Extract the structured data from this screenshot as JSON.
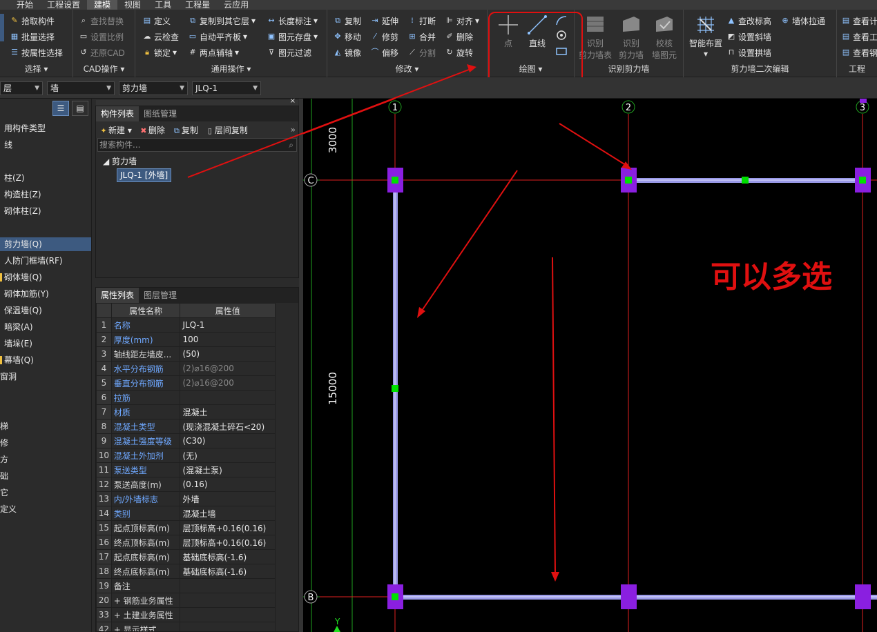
{
  "menu": [
    "开始",
    "工程设置",
    "建模",
    "视图",
    "工具",
    "工程量",
    "云应用"
  ],
  "ribbon": {
    "select": {
      "items": [
        "拾取构件",
        "批量选择",
        "按属性选择"
      ],
      "label": "选择"
    },
    "cad": {
      "items": [
        "查找替换",
        "设置比例",
        "还原CAD"
      ],
      "label": "CAD操作"
    },
    "common": {
      "items": [
        "定义",
        "云检查",
        "锁定",
        "复制到其它层",
        "自动平齐板",
        "两点辅轴",
        "长度标注",
        "图元存盘",
        "图元过滤"
      ],
      "label": "通用操作"
    },
    "modify": {
      "items": [
        "复制",
        "延伸",
        "打断",
        "对齐",
        "移动",
        "修剪",
        "合并",
        "删除",
        "镜像",
        "偏移",
        "分割",
        "旋转"
      ],
      "label": "修改"
    },
    "draw": {
      "point": "点",
      "line": "直线",
      "label": "绘图"
    },
    "recognize": {
      "items": [
        "识别剪力墙表",
        "识别剪力墙",
        "校核墙图元"
      ],
      "label": "识别剪力墙",
      "i1a": "识别",
      "i1b": "剪力墙表",
      "i2a": "识别",
      "i2b": "剪力墙",
      "i3a": "校核",
      "i3b": "墙图元"
    },
    "edit2": {
      "smart": "智能布置",
      "items": [
        "查改标高",
        "墙体拉通",
        "设置斜墙",
        "设置拱墙"
      ],
      "label": "剪力墙二次编辑"
    },
    "project": {
      "items": [
        "查看计",
        "查看工",
        "查看钢"
      ],
      "label": "工程"
    }
  },
  "toolbar2": {
    "c1": "层",
    "c2": "墙",
    "c3": "剪力墙",
    "c4": "JLQ-1"
  },
  "leftnav": [
    "用构件类型",
    "线",
    "柱(Z)",
    "构造柱(Z)",
    "砌体柱(Z)",
    "剪力墙(Q)",
    "人防门框墙(RF)",
    "砌体墙(Q)",
    "砌体加筋(Y)",
    "保温墙(Q)",
    "暗梁(A)",
    "墙垛(E)",
    "幕墙(Q)",
    "窗洞",
    "梯",
    "修",
    "方",
    "础",
    "它",
    "定义"
  ],
  "complist": {
    "tab1": "构件列表",
    "tab2": "图纸管理",
    "new": "新建",
    "del": "删除",
    "copy": "复制",
    "floorcopy": "层间复制",
    "search_placeholder": "搜索构件...",
    "group": "剪力墙",
    "leaf": "JLQ-1 [外墙]"
  },
  "proplist": {
    "tab1": "属性列表",
    "tab2": "图层管理",
    "h_name": "属性名称",
    "h_val": "属性值",
    "rows": [
      {
        "n": "1",
        "name": "名称",
        "val": "JLQ-1"
      },
      {
        "n": "2",
        "name": "厚度(mm)",
        "val": "100"
      },
      {
        "n": "3",
        "name": "轴线距左墙皮...",
        "val": "(50)"
      },
      {
        "n": "4",
        "name": "水平分布钢筋",
        "val": "(2)⌀16@200"
      },
      {
        "n": "5",
        "name": "垂直分布钢筋",
        "val": "(2)⌀16@200"
      },
      {
        "n": "6",
        "name": "拉筋",
        "val": ""
      },
      {
        "n": "7",
        "name": "材质",
        "val": "混凝土"
      },
      {
        "n": "8",
        "name": "混凝土类型",
        "val": "(现浇混凝土碎石<20)"
      },
      {
        "n": "9",
        "name": "混凝土强度等级",
        "val": "(C30)"
      },
      {
        "n": "10",
        "name": "混凝土外加剂",
        "val": "(无)"
      },
      {
        "n": "11",
        "name": "泵送类型",
        "val": "(混凝土泵)"
      },
      {
        "n": "12",
        "name": "泵送高度(m)",
        "val": "(0.16)"
      },
      {
        "n": "13",
        "name": "内/外墙标志",
        "val": "外墙"
      },
      {
        "n": "14",
        "name": "类别",
        "val": "混凝土墙"
      },
      {
        "n": "15",
        "name": "起点顶标高(m)",
        "val": "层顶标高+0.16(0.16)"
      },
      {
        "n": "16",
        "name": "终点顶标高(m)",
        "val": "层顶标高+0.16(0.16)"
      },
      {
        "n": "17",
        "name": "起点底标高(m)",
        "val": "基础底标高(-1.6)"
      },
      {
        "n": "18",
        "name": "终点底标高(m)",
        "val": "基础底标高(-1.6)"
      },
      {
        "n": "19",
        "name": "备注",
        "val": ""
      },
      {
        "n": "20",
        "name": "+ 钢筋业务属性",
        "val": ""
      },
      {
        "n": "33",
        "name": "+ 土建业务属性",
        "val": ""
      },
      {
        "n": "42",
        "name": "+ 显示样式",
        "val": ""
      }
    ]
  },
  "canvas": {
    "axis_top": [
      "1",
      "2",
      "3"
    ],
    "axis_left": [
      "C",
      "B"
    ],
    "dim_3000": "3000",
    "dim_15000": "15000",
    "annotation": "可以多选",
    "y_axis": "Y"
  },
  "colors": {
    "accent": "#e01010",
    "wall": "#9a9ae8",
    "column": "#8a1fe0",
    "handle": "#00e000",
    "grid": "#e02020"
  }
}
